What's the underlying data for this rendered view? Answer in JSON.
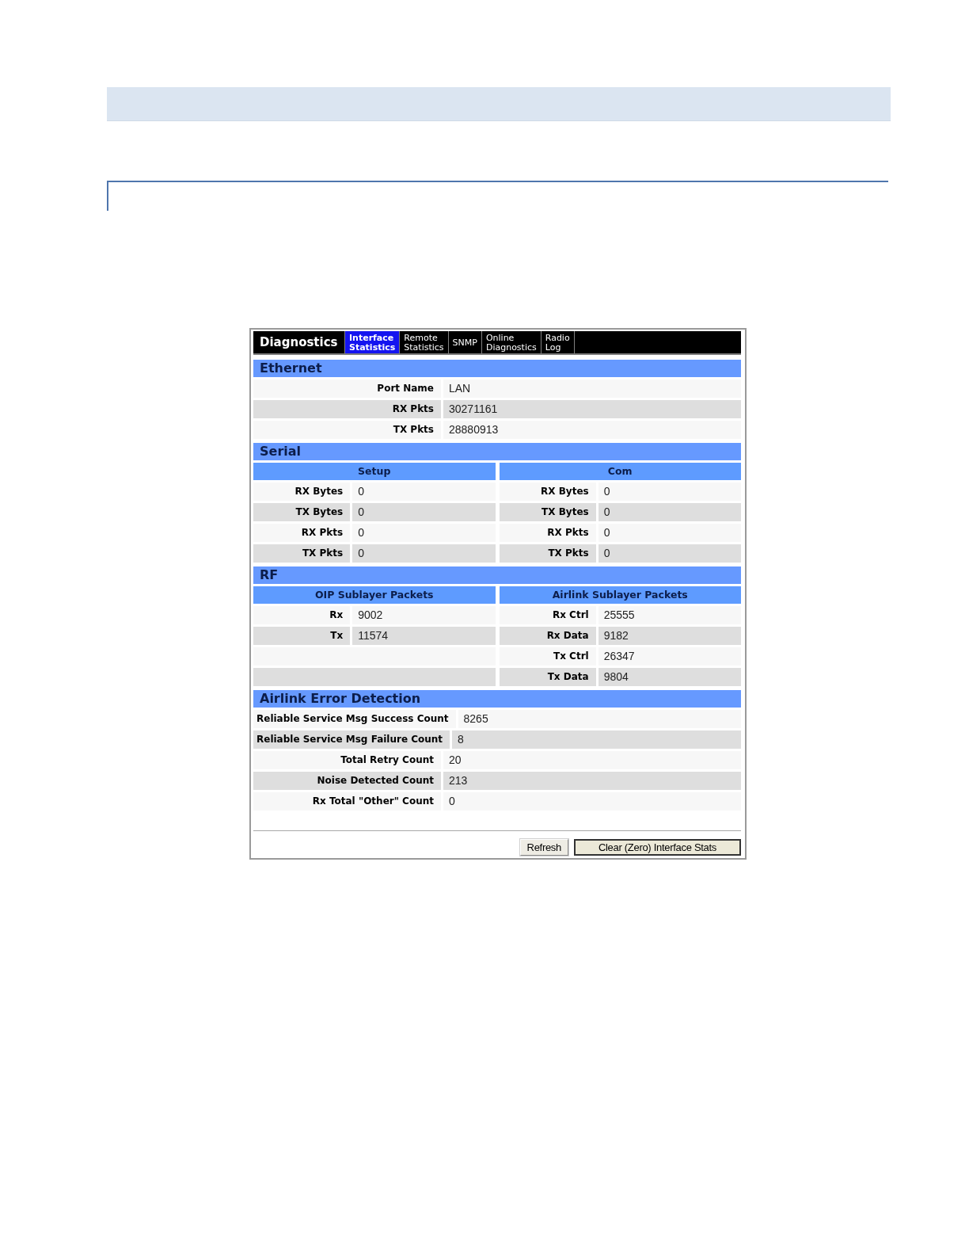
{
  "app": {
    "title": "Diagnostics"
  },
  "tabs": [
    {
      "label": "Interface Statistics",
      "selected": true
    },
    {
      "label": "Remote Statistics",
      "selected": false
    },
    {
      "label": "SNMP",
      "selected": false
    },
    {
      "label": "Online Diagnostics",
      "selected": false
    },
    {
      "label": "Radio Log",
      "selected": false
    }
  ],
  "sections": [
    {
      "kind": "single",
      "title": "Ethernet",
      "rows": [
        {
          "label": "Port Name",
          "value": "LAN"
        },
        {
          "label": "RX Pkts",
          "value": "30271161"
        },
        {
          "label": "TX Pkts",
          "value": "28880913"
        }
      ]
    },
    {
      "kind": "split",
      "title": "Serial",
      "columns": [
        {
          "heading": "Setup",
          "rows": [
            {
              "label": "RX Bytes",
              "value": "0"
            },
            {
              "label": "TX Bytes",
              "value": "0"
            },
            {
              "label": "RX Pkts",
              "value": "0"
            },
            {
              "label": "TX Pkts",
              "value": "0"
            }
          ]
        },
        {
          "heading": "Com",
          "rows": [
            {
              "label": "RX Bytes",
              "value": "0"
            },
            {
              "label": "TX Bytes",
              "value": "0"
            },
            {
              "label": "RX Pkts",
              "value": "0"
            },
            {
              "label": "TX Pkts",
              "value": "0"
            }
          ]
        }
      ]
    },
    {
      "kind": "split",
      "title": "RF",
      "columns": [
        {
          "heading": "OIP Sublayer Packets",
          "rows": [
            {
              "label": "Rx",
              "value": "9002"
            },
            {
              "label": "Tx",
              "value": "11574"
            }
          ]
        },
        {
          "heading": "Airlink Sublayer Packets",
          "rows": [
            {
              "label": "Rx Ctrl",
              "value": "25555"
            },
            {
              "label": "Rx Data",
              "value": "9182"
            },
            {
              "label": "Tx Ctrl",
              "value": "26347"
            },
            {
              "label": "Tx Data",
              "value": "9804"
            }
          ]
        }
      ]
    },
    {
      "kind": "single",
      "title": "Airlink Error Detection",
      "rows": [
        {
          "label": "Reliable Service Msg Success Count",
          "value": "8265"
        },
        {
          "label": "Reliable Service Msg Failure Count",
          "value": "8"
        },
        {
          "label": "Total Retry Count",
          "value": "20"
        },
        {
          "label": "Noise Detected Count",
          "value": "213"
        },
        {
          "label": "Rx Total \"Other\" Count",
          "value": "0"
        }
      ]
    }
  ],
  "buttons": [
    {
      "label": "Refresh",
      "default": false
    },
    {
      "label": "Clear (Zero) Interface Stats",
      "default": true
    }
  ]
}
